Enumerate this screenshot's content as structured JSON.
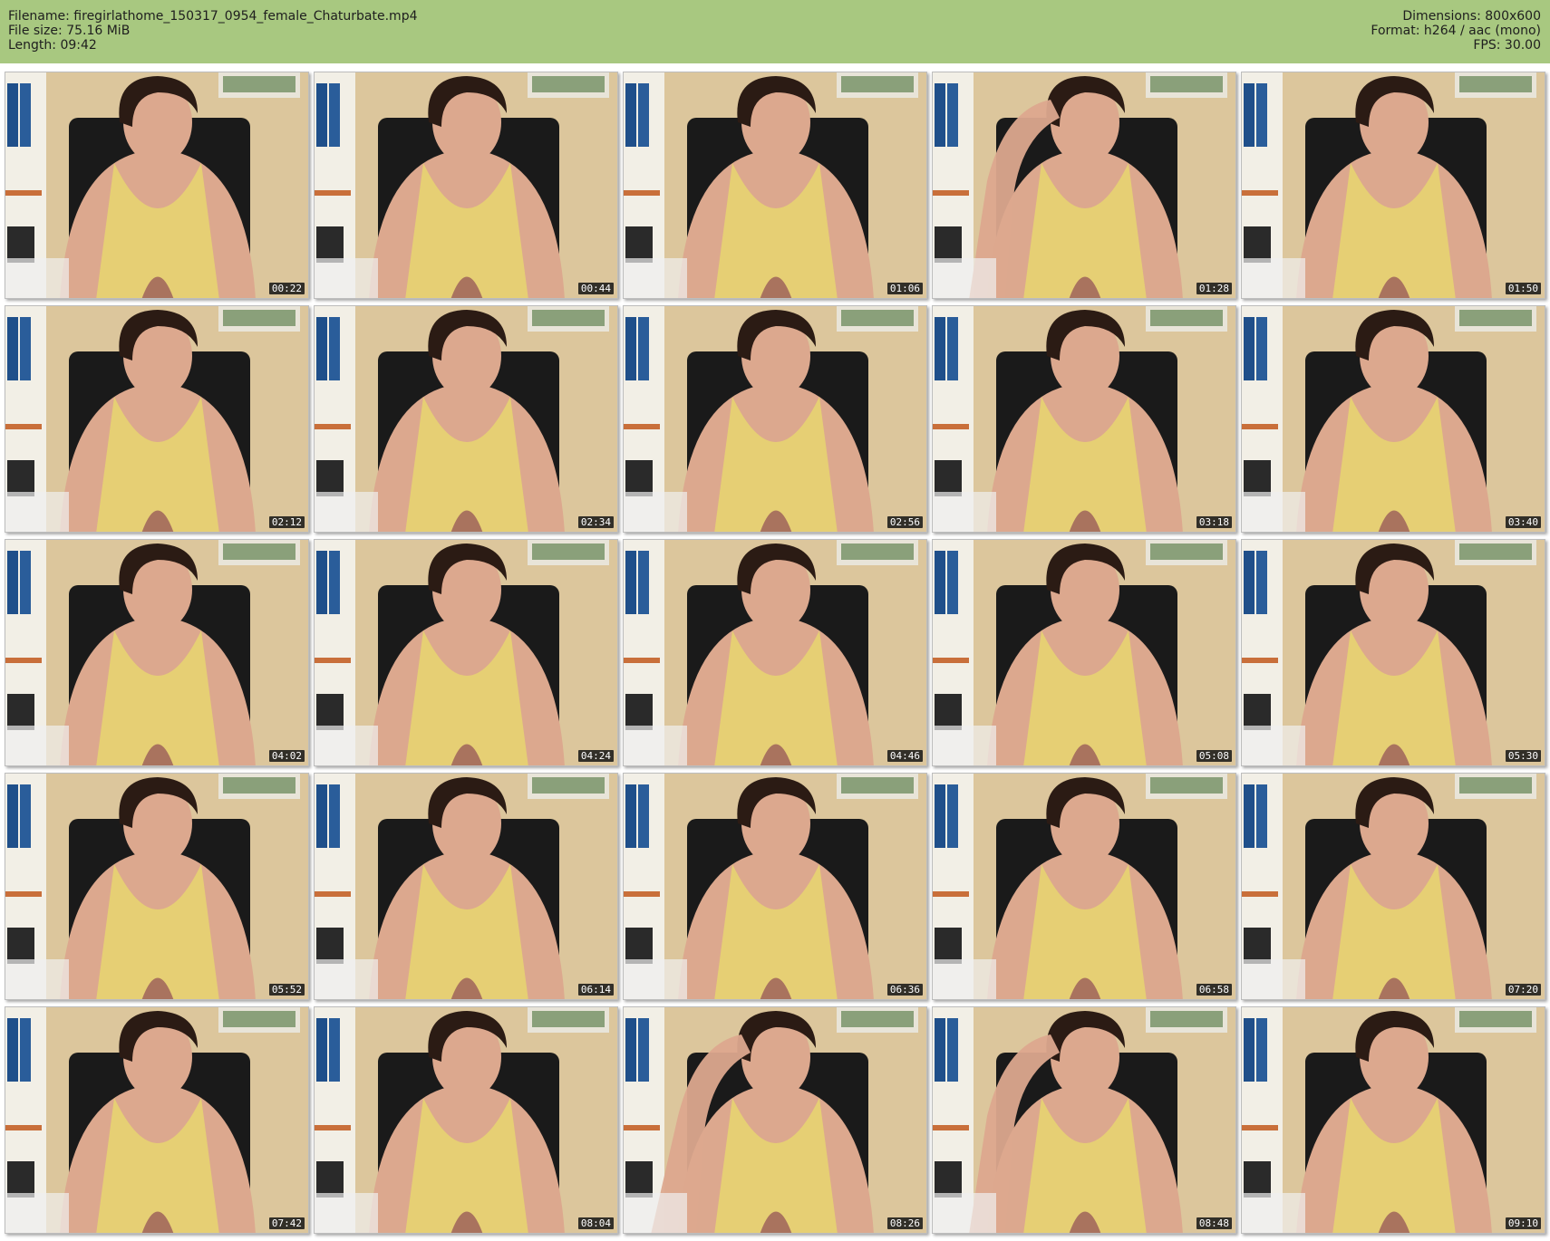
{
  "header": {
    "filename_line": "Filename: firegirlathome_150317_0954_female_Chaturbate.mp4",
    "filesize_line": "File size: 75.16 MiB",
    "length_line": "Length: 09:42",
    "dimensions_line": "Dimensions: 800x600",
    "format_line": "Format: h264 / aac (mono)",
    "fps_line": "FPS: 30.00"
  },
  "colors": {
    "header_bg": "#a8c880",
    "top_color": "#e6cf74",
    "wall": "#dcc69c",
    "chair": "#1a1a1a",
    "hair": "#2b1b14",
    "skin": "#dca88e"
  },
  "thumbnails": [
    {
      "time": "00:22"
    },
    {
      "time": "00:44"
    },
    {
      "time": "01:06"
    },
    {
      "time": "01:28"
    },
    {
      "time": "01:50"
    },
    {
      "time": "02:12"
    },
    {
      "time": "02:34"
    },
    {
      "time": "02:56"
    },
    {
      "time": "03:18"
    },
    {
      "time": "03:40"
    },
    {
      "time": "04:02"
    },
    {
      "time": "04:24"
    },
    {
      "time": "04:46"
    },
    {
      "time": "05:08"
    },
    {
      "time": "05:30"
    },
    {
      "time": "05:52"
    },
    {
      "time": "06:14"
    },
    {
      "time": "06:36"
    },
    {
      "time": "06:58"
    },
    {
      "time": "07:20"
    },
    {
      "time": "07:42"
    },
    {
      "time": "08:04"
    },
    {
      "time": "08:26"
    },
    {
      "time": "08:48"
    },
    {
      "time": "09:10"
    }
  ]
}
